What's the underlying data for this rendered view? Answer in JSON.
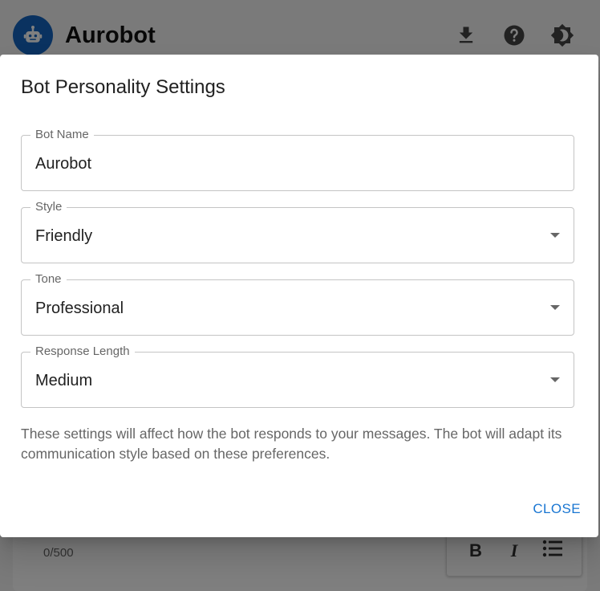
{
  "app": {
    "title": "Aurobot",
    "actions": [
      {
        "name": "download-icon"
      },
      {
        "name": "help-icon"
      },
      {
        "name": "theme-toggle-icon"
      }
    ],
    "composer": {
      "char_count": "0/500",
      "format_buttons": [
        {
          "label": "B",
          "icon": "bold-icon"
        },
        {
          "label": "I",
          "icon": "italic-icon"
        },
        {
          "icon": "bulleted-list-icon"
        }
      ]
    }
  },
  "dialog": {
    "title": "Bot Personality Settings",
    "fields": {
      "bot_name": {
        "label": "Bot Name",
        "value": "Aurobot"
      },
      "style": {
        "label": "Style",
        "value": "Friendly"
      },
      "tone": {
        "label": "Tone",
        "value": "Professional"
      },
      "response_length": {
        "label": "Response Length",
        "value": "Medium"
      }
    },
    "help_text": "These settings will affect how the bot responds to your messages. The bot will adapt its communication style based on these preferences.",
    "close_label": "CLOSE"
  },
  "colors": {
    "accent": "#1976d2",
    "logo_bg": "#1565c0"
  }
}
